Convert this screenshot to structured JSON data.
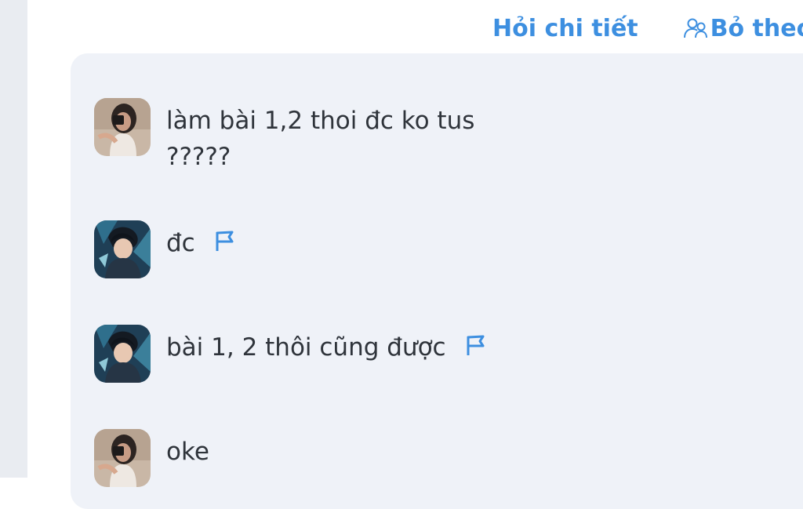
{
  "actions": {
    "ask_detail": "Hỏi chi tiết",
    "unfollow": "Bỏ theo"
  },
  "comments": [
    {
      "avatar": "girl-avatar",
      "lines": [
        "làm bài 1,2 thoi đc ko tus",
        "?????"
      ],
      "flag": false
    },
    {
      "avatar": "anime-avatar",
      "lines": [
        "đc"
      ],
      "flag": true
    },
    {
      "avatar": "anime-avatar",
      "lines": [
        "bài 1, 2 thôi cũng được"
      ],
      "flag": true
    },
    {
      "avatar": "girl-avatar",
      "lines": [
        "oke"
      ],
      "flag": false
    }
  ],
  "colors": {
    "accent": "#3d8fe0",
    "panel": "#eff2f8",
    "text": "#2f343b"
  }
}
